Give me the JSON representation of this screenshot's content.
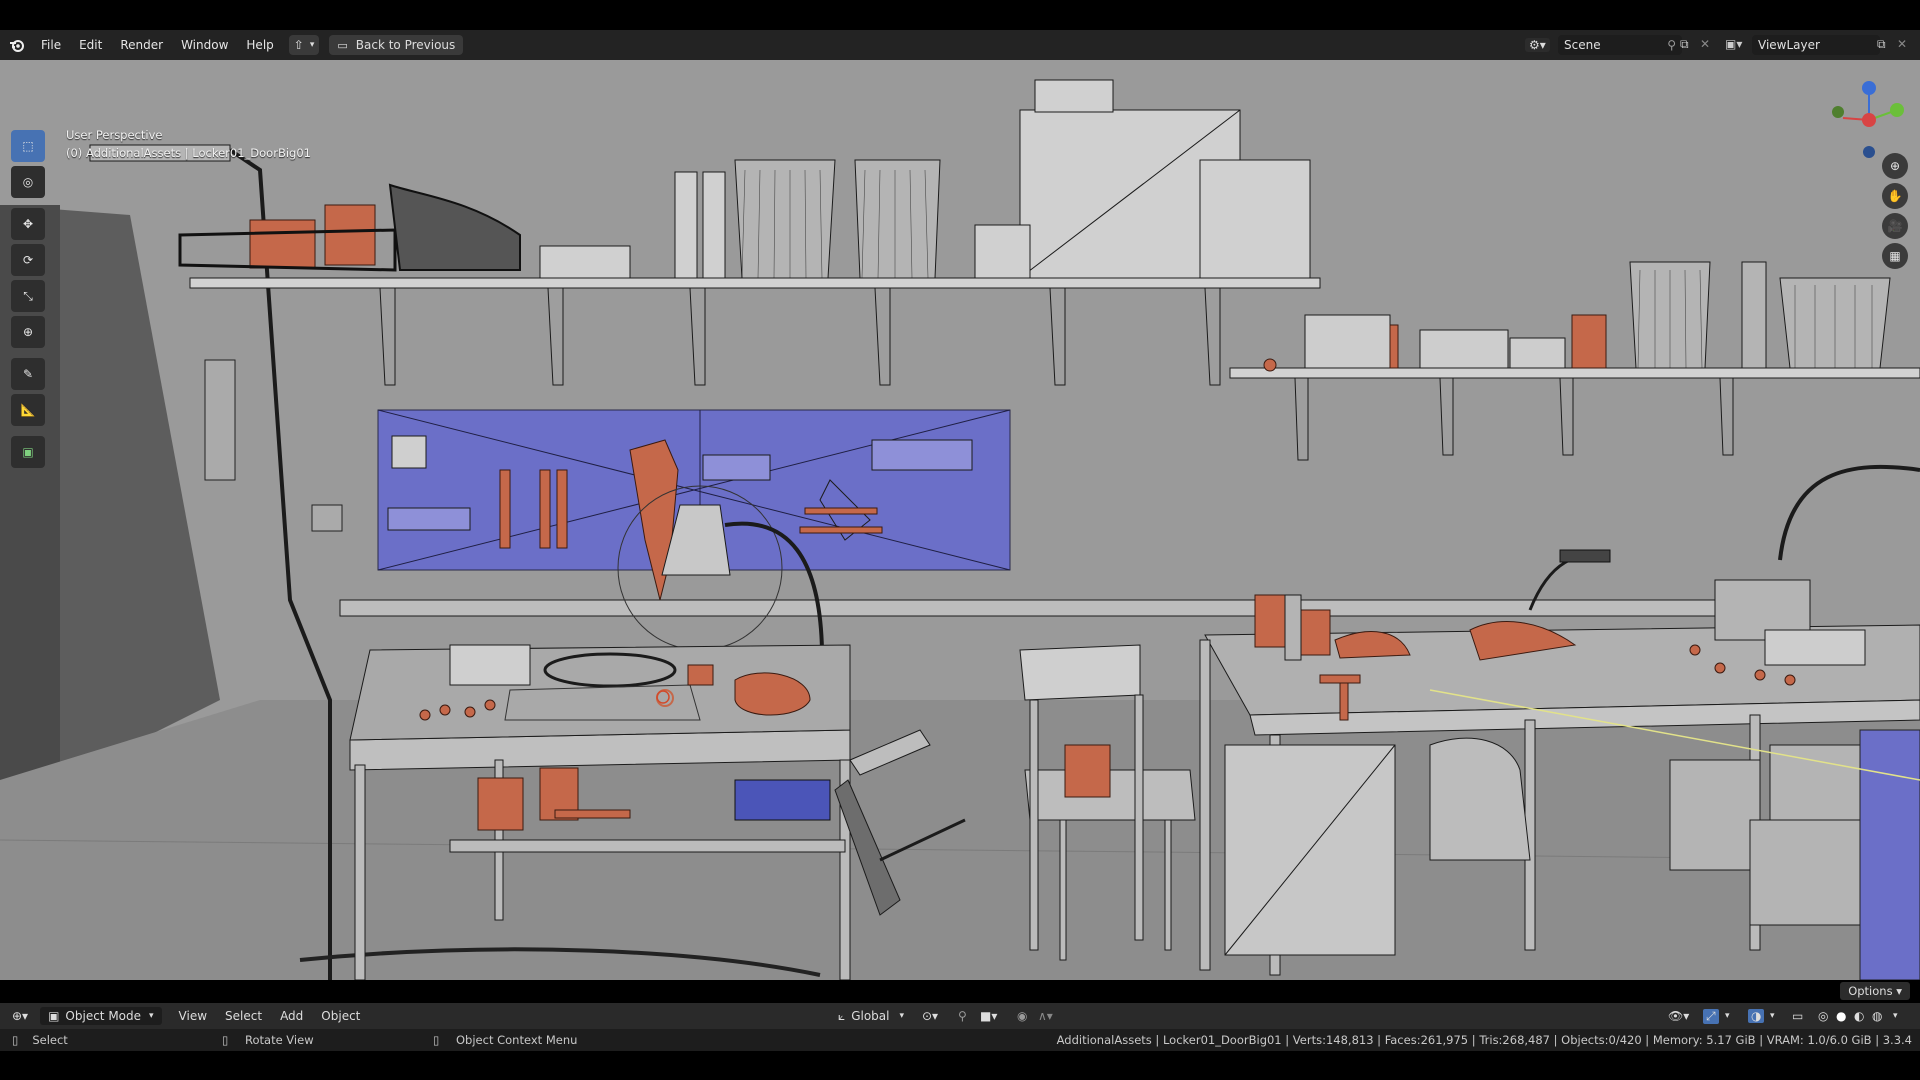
{
  "menu": {
    "items": [
      "File",
      "Edit",
      "Render",
      "Window",
      "Help"
    ],
    "back_button": "Back to Previous"
  },
  "scene": {
    "label": "Scene"
  },
  "view_layer": {
    "label": "ViewLayer"
  },
  "viewport": {
    "perspective": "User Perspective",
    "active_object": "(0) AdditionalAssets | Locker01_DoorBig01"
  },
  "header": {
    "mode": "Object Mode",
    "menus": [
      "View",
      "Select",
      "Add",
      "Object"
    ],
    "transform_orientation": "Global",
    "options": "Options"
  },
  "status": {
    "left_action": "Select",
    "middle_action": "Rotate View",
    "right_action": "Object Context Menu",
    "stats": "AdditionalAssets | Locker01_DoorBig01 | Verts:148,813 | Faces:261,975 | Tris:268,487 | Objects:0/420 | Memory: 5.17 GiB | VRAM: 1.0/6.0 GiB | 3.3.4"
  },
  "colors": {
    "accent": "#4772b3",
    "selected_panel": "#6b6fc8",
    "props": "#c5684a",
    "wire": "#1a1a1a"
  }
}
